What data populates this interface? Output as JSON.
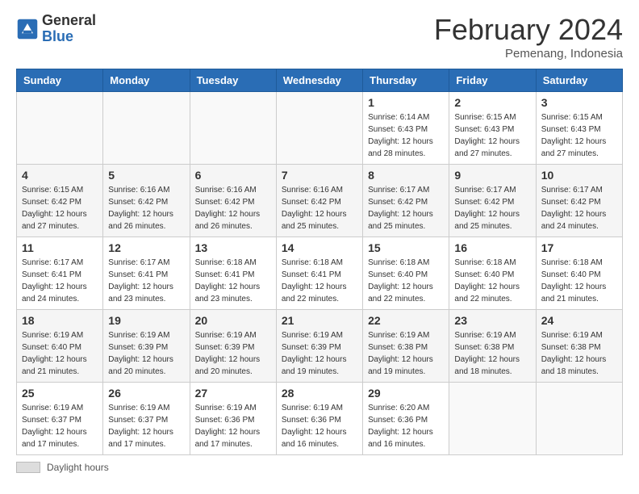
{
  "header": {
    "logo_general": "General",
    "logo_blue": "Blue",
    "month_title": "February 2024",
    "subtitle": "Pemenang, Indonesia"
  },
  "calendar": {
    "days_of_week": [
      "Sunday",
      "Monday",
      "Tuesday",
      "Wednesday",
      "Thursday",
      "Friday",
      "Saturday"
    ],
    "weeks": [
      [
        {
          "day": "",
          "info": ""
        },
        {
          "day": "",
          "info": ""
        },
        {
          "day": "",
          "info": ""
        },
        {
          "day": "",
          "info": ""
        },
        {
          "day": "1",
          "info": "Sunrise: 6:14 AM\nSunset: 6:43 PM\nDaylight: 12 hours\nand 28 minutes."
        },
        {
          "day": "2",
          "info": "Sunrise: 6:15 AM\nSunset: 6:43 PM\nDaylight: 12 hours\nand 27 minutes."
        },
        {
          "day": "3",
          "info": "Sunrise: 6:15 AM\nSunset: 6:43 PM\nDaylight: 12 hours\nand 27 minutes."
        }
      ],
      [
        {
          "day": "4",
          "info": "Sunrise: 6:15 AM\nSunset: 6:42 PM\nDaylight: 12 hours\nand 27 minutes."
        },
        {
          "day": "5",
          "info": "Sunrise: 6:16 AM\nSunset: 6:42 PM\nDaylight: 12 hours\nand 26 minutes."
        },
        {
          "day": "6",
          "info": "Sunrise: 6:16 AM\nSunset: 6:42 PM\nDaylight: 12 hours\nand 26 minutes."
        },
        {
          "day": "7",
          "info": "Sunrise: 6:16 AM\nSunset: 6:42 PM\nDaylight: 12 hours\nand 25 minutes."
        },
        {
          "day": "8",
          "info": "Sunrise: 6:17 AM\nSunset: 6:42 PM\nDaylight: 12 hours\nand 25 minutes."
        },
        {
          "day": "9",
          "info": "Sunrise: 6:17 AM\nSunset: 6:42 PM\nDaylight: 12 hours\nand 25 minutes."
        },
        {
          "day": "10",
          "info": "Sunrise: 6:17 AM\nSunset: 6:42 PM\nDaylight: 12 hours\nand 24 minutes."
        }
      ],
      [
        {
          "day": "11",
          "info": "Sunrise: 6:17 AM\nSunset: 6:41 PM\nDaylight: 12 hours\nand 24 minutes."
        },
        {
          "day": "12",
          "info": "Sunrise: 6:17 AM\nSunset: 6:41 PM\nDaylight: 12 hours\nand 23 minutes."
        },
        {
          "day": "13",
          "info": "Sunrise: 6:18 AM\nSunset: 6:41 PM\nDaylight: 12 hours\nand 23 minutes."
        },
        {
          "day": "14",
          "info": "Sunrise: 6:18 AM\nSunset: 6:41 PM\nDaylight: 12 hours\nand 22 minutes."
        },
        {
          "day": "15",
          "info": "Sunrise: 6:18 AM\nSunset: 6:40 PM\nDaylight: 12 hours\nand 22 minutes."
        },
        {
          "day": "16",
          "info": "Sunrise: 6:18 AM\nSunset: 6:40 PM\nDaylight: 12 hours\nand 22 minutes."
        },
        {
          "day": "17",
          "info": "Sunrise: 6:18 AM\nSunset: 6:40 PM\nDaylight: 12 hours\nand 21 minutes."
        }
      ],
      [
        {
          "day": "18",
          "info": "Sunrise: 6:19 AM\nSunset: 6:40 PM\nDaylight: 12 hours\nand 21 minutes."
        },
        {
          "day": "19",
          "info": "Sunrise: 6:19 AM\nSunset: 6:39 PM\nDaylight: 12 hours\nand 20 minutes."
        },
        {
          "day": "20",
          "info": "Sunrise: 6:19 AM\nSunset: 6:39 PM\nDaylight: 12 hours\nand 20 minutes."
        },
        {
          "day": "21",
          "info": "Sunrise: 6:19 AM\nSunset: 6:39 PM\nDaylight: 12 hours\nand 19 minutes."
        },
        {
          "day": "22",
          "info": "Sunrise: 6:19 AM\nSunset: 6:38 PM\nDaylight: 12 hours\nand 19 minutes."
        },
        {
          "day": "23",
          "info": "Sunrise: 6:19 AM\nSunset: 6:38 PM\nDaylight: 12 hours\nand 18 minutes."
        },
        {
          "day": "24",
          "info": "Sunrise: 6:19 AM\nSunset: 6:38 PM\nDaylight: 12 hours\nand 18 minutes."
        }
      ],
      [
        {
          "day": "25",
          "info": "Sunrise: 6:19 AM\nSunset: 6:37 PM\nDaylight: 12 hours\nand 17 minutes."
        },
        {
          "day": "26",
          "info": "Sunrise: 6:19 AM\nSunset: 6:37 PM\nDaylight: 12 hours\nand 17 minutes."
        },
        {
          "day": "27",
          "info": "Sunrise: 6:19 AM\nSunset: 6:36 PM\nDaylight: 12 hours\nand 17 minutes."
        },
        {
          "day": "28",
          "info": "Sunrise: 6:19 AM\nSunset: 6:36 PM\nDaylight: 12 hours\nand 16 minutes."
        },
        {
          "day": "29",
          "info": "Sunrise: 6:20 AM\nSunset: 6:36 PM\nDaylight: 12 hours\nand 16 minutes."
        },
        {
          "day": "",
          "info": ""
        },
        {
          "day": "",
          "info": ""
        }
      ]
    ]
  },
  "legend": {
    "label": "Daylight hours"
  }
}
